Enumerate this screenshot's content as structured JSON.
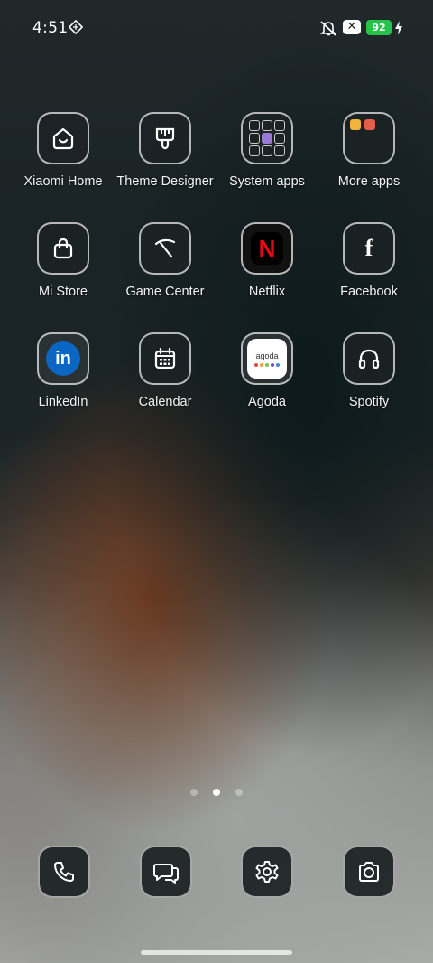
{
  "status_bar": {
    "time": "4:51",
    "battery_level": "92",
    "battery_color": "#27c24c",
    "icons": [
      "notification-icon",
      "mute-icon",
      "x-badge-icon",
      "charging-icon"
    ]
  },
  "apps": [
    {
      "name": "Xiaomi Home",
      "icon": "home-icon"
    },
    {
      "name": "Theme Designer",
      "icon": "paintbrush-icon"
    },
    {
      "name": "System apps",
      "icon": "folder-icon"
    },
    {
      "name": "More apps",
      "icon": "folder-icon"
    },
    {
      "name": "Mi Store",
      "icon": "shopping-bag-icon"
    },
    {
      "name": "Game Center",
      "icon": "game-center-icon"
    },
    {
      "name": "Netflix",
      "icon": "netflix-icon",
      "icon_text": "N",
      "color": "#e50914"
    },
    {
      "name": "Facebook",
      "icon": "facebook-icon",
      "icon_text": "f"
    },
    {
      "name": "LinkedIn",
      "icon": "linkedin-icon",
      "icon_text": "in",
      "color": "#0a66c2"
    },
    {
      "name": "Calendar",
      "icon": "calendar-icon"
    },
    {
      "name": "Agoda",
      "icon": "agoda-icon",
      "icon_text": "agoda"
    },
    {
      "name": "Spotify",
      "icon": "headphones-icon"
    }
  ],
  "page_indicator": {
    "pages": 3,
    "current": 2
  },
  "dock": [
    {
      "icon": "phone-icon"
    },
    {
      "icon": "messages-icon"
    },
    {
      "icon": "settings-icon"
    },
    {
      "icon": "camera-icon"
    }
  ]
}
